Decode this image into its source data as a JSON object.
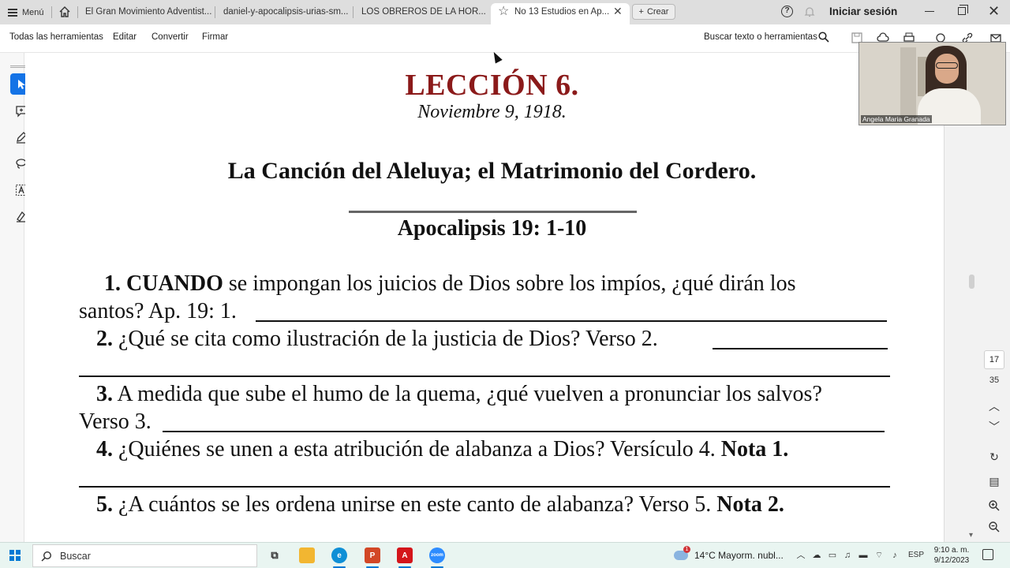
{
  "tabbar": {
    "menu_label": "Menú",
    "tabs": [
      {
        "label": "El Gran Movimiento Adventist..."
      },
      {
        "label": "daniel-y-apocalipsis-urias-sm..."
      },
      {
        "label": "LOS OBREROS DE LA HOR..."
      },
      {
        "label": "No 13 Estudios en Ap..."
      }
    ],
    "create_label": "Crear",
    "signin_label": "Iniciar sesión"
  },
  "toolbar": {
    "items": [
      "Todas las herramientas",
      "Editar",
      "Convertir",
      "Firmar"
    ],
    "search_label": "Buscar texto o herramientas"
  },
  "document": {
    "lesson_title": "LECCIÓN 6.",
    "date": "Noviembre 9, 1918.",
    "topic": "La Canción del Aleluya; el Matrimonio del Cordero.",
    "reference": "Apocalipsis 19: 1-10",
    "q1_num": "1.",
    "q1_lead": "CUANDO",
    "q1_text": "se impongan los juicios de Dios sobre los impíos, ¿qué dirán los",
    "q1_line2": "santos? Ap. 19: 1.",
    "q2_num": "2.",
    "q2_text": "¿Qué se cita como ilustración de la justicia de Dios? Verso 2.",
    "q3_num": "3.",
    "q3_text": "A medida que sube el humo de la quema, ¿qué vuelven a pronunciar los salvos?",
    "q3_line2": "Verso 3.",
    "q4_num": "4.",
    "q4_text": "¿Quiénes se unen a esta atribución de alabanza a Dios? Versículo 4.",
    "q4_note": "Nota 1.",
    "q5_num": "5.",
    "q5_text": "¿A cuántos se les ordena unirse en este canto de alabanza? Verso 5.",
    "q5_note": "Nota 2."
  },
  "pager": {
    "current_page": "17",
    "total_pages": "35"
  },
  "video": {
    "participant_name": "Angela Maria Granada"
  },
  "taskbar": {
    "search_placeholder": "Buscar",
    "weather": "14°C  Mayorm. nubl...",
    "weather_badge": "1",
    "language": "ESP",
    "time": "9:10 a. m.",
    "date": "9/12/2023"
  },
  "colors": {
    "lesson_title": "#8b1a1a",
    "accent": "#1473e6",
    "taskbar": "#e9f5f1"
  }
}
